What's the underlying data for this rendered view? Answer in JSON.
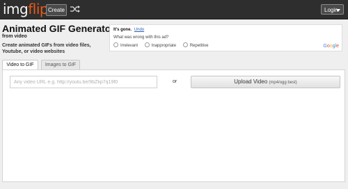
{
  "header": {
    "logo_part1": "img",
    "logo_part2": "flip",
    "create_label": "Create",
    "login_label": "Login"
  },
  "page": {
    "title": "Animated GIF Generator",
    "subtitle": "from video",
    "description": "Create animated GIFs from video files, Youtube, or video websites"
  },
  "ad_feedback": {
    "gone_text": "It's gone.",
    "undo_label": "Undo",
    "question": "What was wrong with this ad?",
    "options": [
      "Irrelevant",
      "Inappropriate",
      "Repetitive"
    ],
    "brand": [
      "G",
      "o",
      "o",
      "g",
      "l",
      "e"
    ]
  },
  "tabs": [
    {
      "label": "Video to GIF",
      "active": true
    },
    {
      "label": "Images to GIF",
      "active": false
    }
  ],
  "video_form": {
    "url_placeholder": "Any video URL e.g. http://youtu.be/9bZkp7q19f0",
    "or_label": "or",
    "upload_label": "Upload Video",
    "upload_formats": "(mp4/ogg best)"
  }
}
